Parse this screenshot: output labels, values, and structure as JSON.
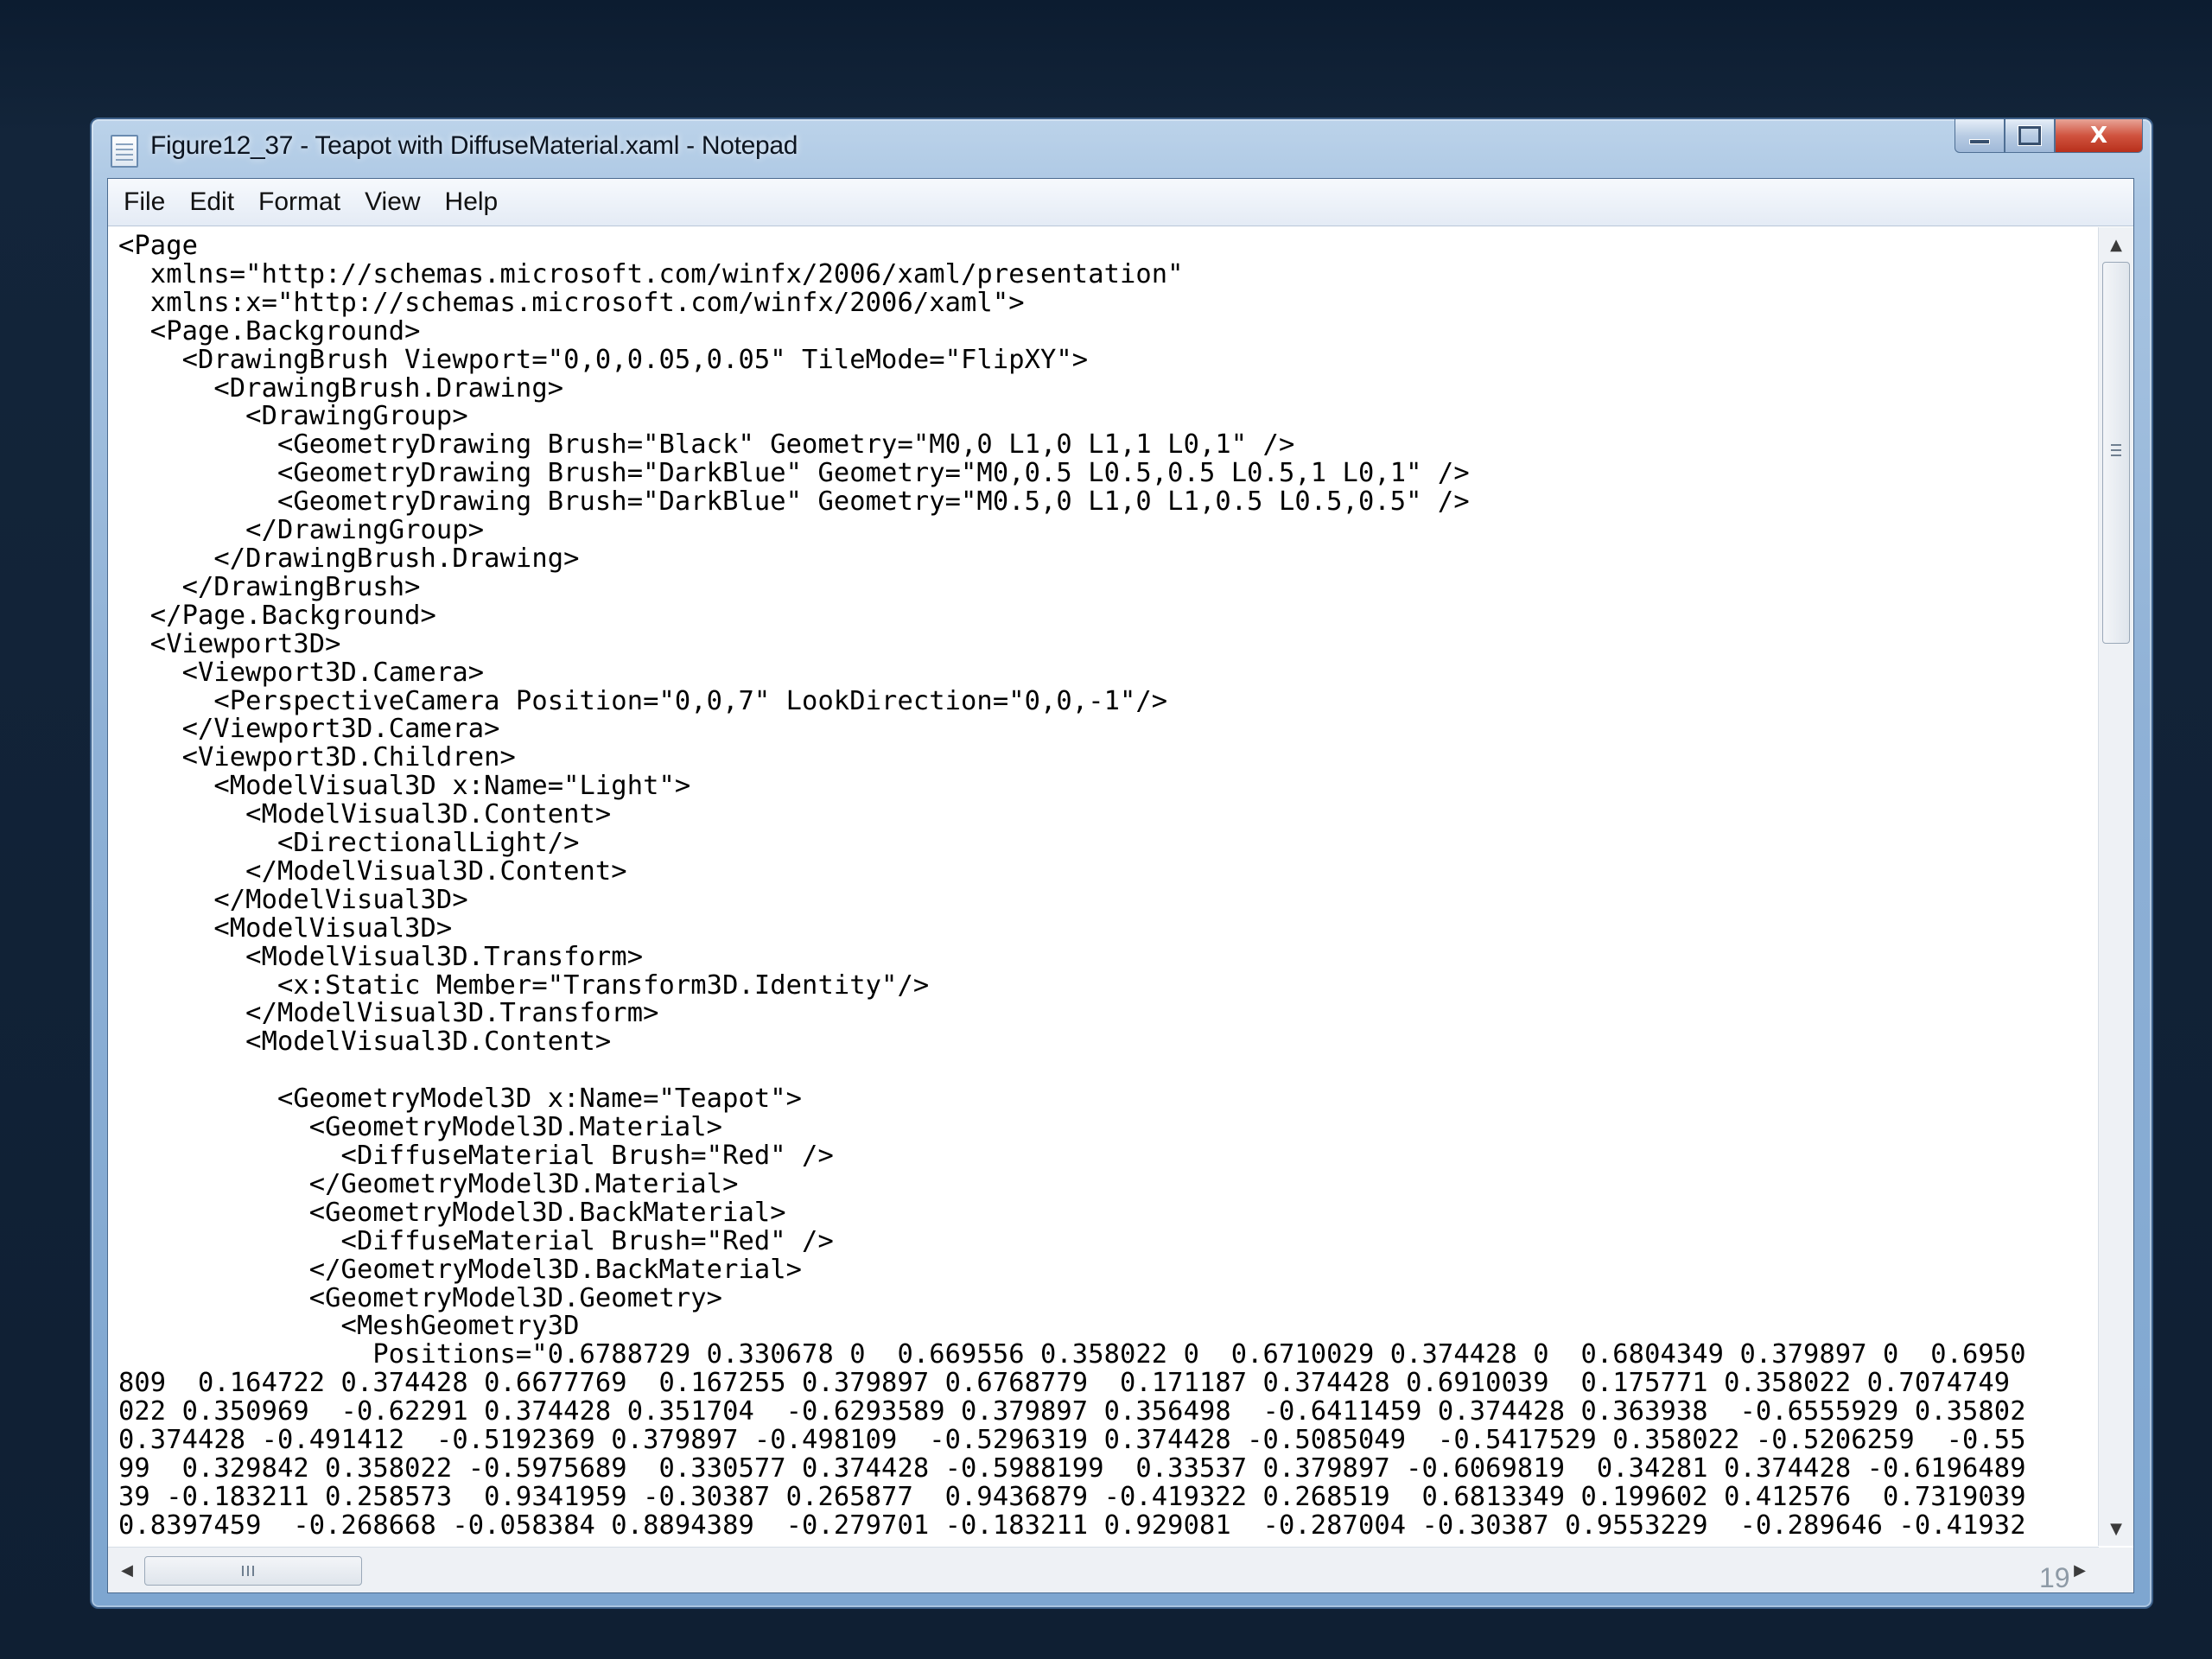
{
  "window": {
    "title": "Figure12_37 - Teapot with DiffuseMaterial.xaml - Notepad",
    "controls": {
      "minimize": "",
      "maximize": "",
      "close": "X"
    }
  },
  "menu": [
    "File",
    "Edit",
    "Format",
    "View",
    "Help"
  ],
  "editor": {
    "lines": [
      "<Page",
      "  xmlns=\"http://schemas.microsoft.com/winfx/2006/xaml/presentation\"",
      "  xmlns:x=\"http://schemas.microsoft.com/winfx/2006/xaml\">",
      "  <Page.Background>",
      "    <DrawingBrush Viewport=\"0,0,0.05,0.05\" TileMode=\"FlipXY\">",
      "      <DrawingBrush.Drawing>",
      "        <DrawingGroup>",
      "          <GeometryDrawing Brush=\"Black\" Geometry=\"M0,0 L1,0 L1,1 L0,1\" />",
      "          <GeometryDrawing Brush=\"DarkBlue\" Geometry=\"M0,0.5 L0.5,0.5 L0.5,1 L0,1\" />",
      "          <GeometryDrawing Brush=\"DarkBlue\" Geometry=\"M0.5,0 L1,0 L1,0.5 L0.5,0.5\" />",
      "        </DrawingGroup>",
      "      </DrawingBrush.Drawing>",
      "    </DrawingBrush>",
      "  </Page.Background>",
      "  <Viewport3D>",
      "    <Viewport3D.Camera>",
      "      <PerspectiveCamera Position=\"0,0,7\" LookDirection=\"0,0,-1\"/>",
      "    </Viewport3D.Camera>",
      "    <Viewport3D.Children>",
      "      <ModelVisual3D x:Name=\"Light\">",
      "        <ModelVisual3D.Content>",
      "          <DirectionalLight/>",
      "        </ModelVisual3D.Content>",
      "      </ModelVisual3D>",
      "      <ModelVisual3D>",
      "        <ModelVisual3D.Transform>",
      "          <x:Static Member=\"Transform3D.Identity\"/>",
      "        </ModelVisual3D.Transform>",
      "        <ModelVisual3D.Content>",
      "",
      "          <GeometryModel3D x:Name=\"Teapot\">",
      "            <GeometryModel3D.Material>",
      "              <DiffuseMaterial Brush=\"Red\" />",
      "            </GeometryModel3D.Material>",
      "            <GeometryModel3D.BackMaterial>",
      "              <DiffuseMaterial Brush=\"Red\" />",
      "            </GeometryModel3D.BackMaterial>",
      "            <GeometryModel3D.Geometry>",
      "              <MeshGeometry3D",
      "                Positions=\"0.6788729 0.330678 0  0.669556 0.358022 0  0.6710029 0.374428 0  0.6804349 0.379897 0  0.6950",
      "809  0.164722 0.374428 0.6677769  0.167255 0.379897 0.6768779  0.171187 0.374428 0.6910039  0.175771 0.358022 0.7074749",
      "022 0.350969  -0.62291 0.374428 0.351704  -0.6293589 0.379897 0.356498  -0.6411459 0.374428 0.363938  -0.6555929 0.35802",
      "0.374428 -0.491412  -0.5192369 0.379897 -0.498109  -0.5296319 0.374428 -0.5085049  -0.5417529 0.358022 -0.5206259  -0.55",
      "99  0.329842 0.358022 -0.5975689  0.330577 0.374428 -0.5988199  0.33537 0.379897 -0.6069819  0.34281 0.374428 -0.6196489",
      "39 -0.183211 0.258573  0.9341959 -0.30387 0.265877  0.9436879 -0.419322 0.268519  0.6813349 0.199602 0.412576  0.7319039",
      "0.8397459  -0.268668 -0.058384 0.8894389  -0.279701 -0.183211 0.929081  -0.287004 -0.30387 0.9553229  -0.289646 -0.41932"
    ]
  },
  "page_number": "19"
}
